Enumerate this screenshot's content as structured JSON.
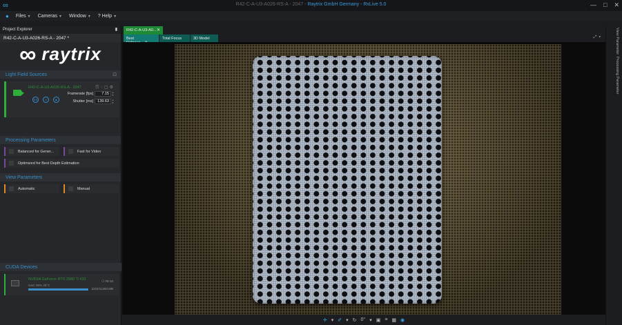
{
  "titlebar": {
    "doc": "R42-C-A-U3-A026-RS-A - 2047 -",
    "app": "Raytrix GmbH Germany - RxLive 5.0",
    "minimize": "—",
    "maximize": "□",
    "close": "✕"
  },
  "menu": {
    "home": "●",
    "files": "Files",
    "cameras": "Cameras",
    "window": "Window",
    "help_icon": "?",
    "help": "Help"
  },
  "project_explorer": {
    "header": "Project Explorer",
    "pin": "▮",
    "project_name": "R42-C-A-U3-A026-RS-A - 2047 *"
  },
  "logo": {
    "symbol": "∞",
    "brand": "raytrix"
  },
  "light_field_sources": {
    "title": "Light Field Sources",
    "camera_name": "R42-C-A-U3-A026-RS-A - 2047",
    "tools": "☶◌▢⚙",
    "controls": [
      "RS",
      "II",
      "■"
    ],
    "framerate_label": "Framerate [fps]",
    "framerate_value": "7.15",
    "shutter_label": "Shutter [ms]",
    "shutter_value": "139.63"
  },
  "processing_parameters": {
    "title": "Processing Parameters",
    "options": [
      "Balanced for Gener...",
      "Fast for Video",
      "Optimized for Best Depth Estimation"
    ]
  },
  "view_parameters": {
    "title": "View Parameters",
    "options": [
      "Automatic",
      "Manual"
    ]
  },
  "cuda_devices": {
    "title": "CUDA Devices",
    "gpu_name": "NVIDIA GeForce RTX 2080 Ti #32",
    "gpu_load": "load: 99%   35°C",
    "load_fraction": 0.99,
    "gpu_version": "⎔ #5-10",
    "gpu_memory": "2222/11263 MB"
  },
  "doc_tab": {
    "label": "R42-C-A-U3-A0...",
    "close": "✕"
  },
  "view_tabs": [
    {
      "label": "Best Refocus",
      "close": "✕"
    },
    {
      "label": "Total Focus"
    },
    {
      "label": "3D Model"
    }
  ],
  "tab_controls": "⤢▾",
  "bottom_toolbar": {
    "items": [
      "✛",
      "▾",
      "✐",
      "▾",
      "↻",
      "0°",
      "▾",
      "▣",
      "≡",
      "▦",
      "◉"
    ]
  },
  "right_panels": [
    "View Parameter",
    "Processing Parameter"
  ],
  "colors": {
    "accent": "#3aa7e8",
    "green": "#2fae3a",
    "teal_tab": "#127a70",
    "purple": "#7a4a9a",
    "orange": "#e08a24"
  }
}
